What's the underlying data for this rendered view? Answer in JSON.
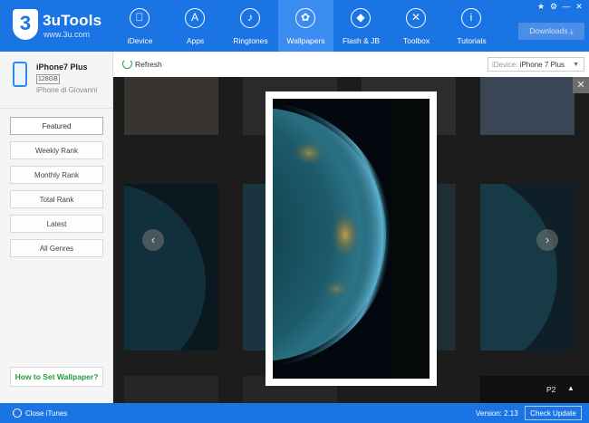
{
  "app": {
    "name": "3uTools",
    "url": "www.3u.com",
    "logo_char": "3"
  },
  "nav": [
    {
      "label": "iDevice",
      "icon": "apple-icon",
      "glyph": ""
    },
    {
      "label": "Apps",
      "icon": "appstore-icon",
      "glyph": "A"
    },
    {
      "label": "Ringtones",
      "icon": "bell-icon",
      "glyph": "♪"
    },
    {
      "label": "Wallpapers",
      "icon": "flower-icon",
      "glyph": "✿",
      "active": true
    },
    {
      "label": "Flash & JB",
      "icon": "dropbox-icon",
      "glyph": "◆"
    },
    {
      "label": "Toolbox",
      "icon": "tools-icon",
      "glyph": "✕"
    },
    {
      "label": "Tutorials",
      "icon": "info-icon",
      "glyph": "i"
    }
  ],
  "window_controls": [
    "★",
    "⚙",
    "—",
    "✕"
  ],
  "downloads": {
    "label": "Downloads",
    "icon": "download-icon",
    "glyph": "⤓"
  },
  "device": {
    "name": "iPhone7 Plus",
    "storage": "128GB",
    "owner": "iPhone di Giovanni"
  },
  "menu": [
    "Featured",
    "Weekly Rank",
    "Monthly Rank",
    "Total Rank",
    "Latest",
    "All Genres"
  ],
  "howto": "How to Set Wallpaper?",
  "toolbar": {
    "refresh": "Refresh",
    "idevice_label": "iDevice:",
    "idevice_value": "iPhone 7 Plus"
  },
  "viewer": {
    "close": "✕",
    "prev": "‹",
    "next": "›",
    "page": "P2",
    "page_up": "▲"
  },
  "status": {
    "itunes": "Close iTunes",
    "version": "Version: 2.13",
    "check": "Check Update"
  },
  "colors": {
    "brand": "#1b74e3",
    "accent_green": "#1b9e3e"
  }
}
